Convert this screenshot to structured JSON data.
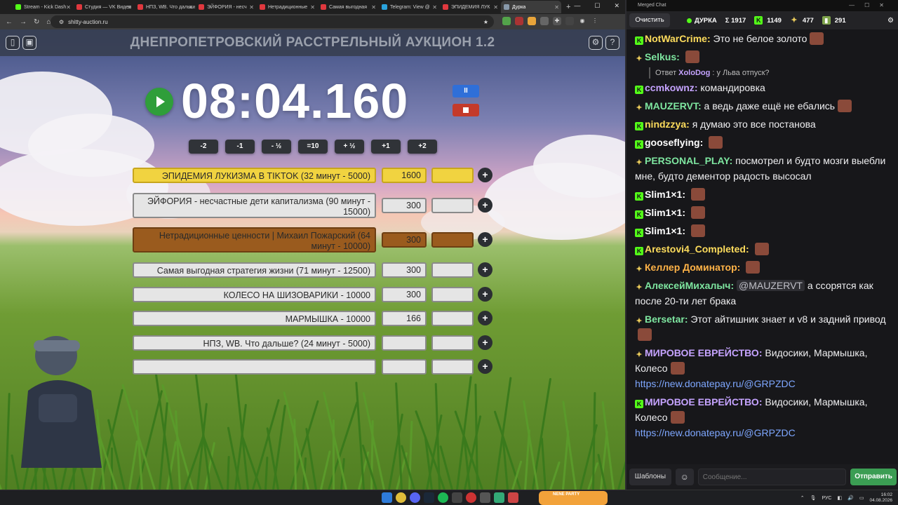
{
  "browser": {
    "tabs": [
      {
        "title": "Stream - Kick Dash",
        "color": "#53fc18",
        "active": false
      },
      {
        "title": "Студия — VK Видео",
        "color": "#e0383e",
        "active": false
      },
      {
        "title": "НПЗ, WB. Что дальше",
        "color": "#e0383e",
        "active": false
      },
      {
        "title": "ЭЙФОРИЯ - несч",
        "color": "#e0383e",
        "active": false
      },
      {
        "title": "Нетрадиционные",
        "color": "#e0383e",
        "active": false
      },
      {
        "title": "Самая выгодная",
        "color": "#e0383e",
        "active": false
      },
      {
        "title": "Telegram: View @",
        "color": "#2aa3dd",
        "active": false
      },
      {
        "title": "ЭПИДЕМИЯ ЛУК",
        "color": "#e0383e",
        "active": false
      },
      {
        "title": "Дурка",
        "color": "#8899aa",
        "active": true
      }
    ],
    "url": "shitty-auction.ru"
  },
  "auction": {
    "title": "ДНЕПРОПЕТРОВСКИЙ РАССТРЕЛЬНЫЙ АУКЦИОН 1.2",
    "timer": "08:04.160",
    "pause_label": "II",
    "adjust_buttons": [
      "-2",
      "-1",
      "- ½",
      "=10",
      "+ ½",
      "+1",
      "+2"
    ],
    "lots": [
      {
        "name": "ЭПИДЕМИЯ ЛУКИЗМА В TIKTOK (32 минут - 5000)",
        "amount": "1600",
        "style": "gold"
      },
      {
        "name": "ЭЙФОРИЯ - несчастные дети капитализма (90 минут - 15000)",
        "amount": "300",
        "style": "grey"
      },
      {
        "name": "Нетрадиционные ценности | Михаил Пожарский (64 минут - 10000)",
        "amount": "300",
        "style": "brown"
      },
      {
        "name": "Самая выгодная стратегия жизни (71 минут - 12500)",
        "amount": "300",
        "style": "grey"
      },
      {
        "name": "КОЛЕСО НА ШИЗОВАРИКИ - 10000",
        "amount": "300",
        "style": "grey"
      },
      {
        "name": "МАРМЫШКА - 10000",
        "amount": "166",
        "style": "grey"
      },
      {
        "name": "НПЗ, WB. Что дальше? (24 минут - 5000)",
        "amount": "",
        "style": "grey"
      },
      {
        "name": "",
        "amount": "",
        "style": "grey"
      }
    ],
    "plus_label": "+"
  },
  "chat": {
    "window_title": "Merged Chat",
    "clear_label": "Очистить",
    "status": "ДУРКА",
    "total": "Σ 1917",
    "kick_count": "1149",
    "other_count": "477",
    "vk_count": "291",
    "messages": [
      {
        "platform": "kick",
        "nick": "NotWarCrime",
        "color": "#fddc5c",
        "text": "Это не белое золото",
        "emote": true
      },
      {
        "platform": "bee",
        "nick": "Selkus",
        "color": "#7ee6a0",
        "text": "",
        "emote": true
      },
      {
        "reply": true,
        "reply_prefix": "Ответ",
        "reply_nick": "XoloDog",
        "reply_text": "у Льва отпуск?"
      },
      {
        "platform": "kick",
        "nick": "ccmkownz",
        "color": "#c5a3ff",
        "text": "командировка",
        "emote": false
      },
      {
        "platform": "bee",
        "nick": "MAUZERVT",
        "color": "#7ee6a0",
        "text": "а ведь даже ещё не ебались",
        "emote": true
      },
      {
        "platform": "kick",
        "nick": "nindzzya",
        "color": "#fddc5c",
        "text": "я думаю это все постанова",
        "emote": false
      },
      {
        "platform": "kick",
        "nick": "gooseflying",
        "color": "#ffffff",
        "text": "",
        "emote": true
      },
      {
        "platform": "bee",
        "nick": "PERSONAL_PLAY",
        "color": "#7ee6a0",
        "text": "посмотрел и будто мозги выебли мне, будто дементор радость высосал",
        "emote": false
      },
      {
        "platform": "kick",
        "nick": "Slim1×1",
        "color": "#ffffff",
        "text": "",
        "emote": true
      },
      {
        "platform": "kick",
        "nick": "Slim1×1",
        "color": "#ffffff",
        "text": "",
        "emote": true
      },
      {
        "platform": "kick",
        "nick": "Slim1×1",
        "color": "#ffffff",
        "text": "",
        "emote": true
      },
      {
        "platform": "kick",
        "nick": "Arestovi4_Completed",
        "color": "#fddc5c",
        "text": "",
        "emote": true
      },
      {
        "platform": "bee",
        "nick": "Келлер Доминатор",
        "color": "#ffb347",
        "text": "",
        "emote": true
      },
      {
        "platform": "bee",
        "nick": "АлексейМихалыч",
        "color": "#7ee6a0",
        "mention": "@MAUZERVT",
        "text": "а ссорятся как после 20-ти лет брака",
        "emote": false
      },
      {
        "platform": "bee",
        "nick": "Bersetar",
        "color": "#7ee6a0",
        "text": "Этот айтишник знает и v8 и задний привод",
        "emote": true
      },
      {
        "platform": "bee",
        "nick": "МИРОВОЕ ЕВРЕЙСТВО",
        "color": "#c5a3ff",
        "text": "Видосики, Мармышка, Колесо",
        "emote": true,
        "link": "https://new.donatepay.ru/@GRPZDC"
      },
      {
        "platform": "kick",
        "nick": "МИРОВОЕ ЕВРЕЙСТВО",
        "color": "#c5a3ff",
        "text": "Видосики, Мармышка, Колесо",
        "emote": true,
        "link": "https://new.donatepay.ru/@GRPZDC"
      }
    ],
    "templates_label": "Шаблоны",
    "input_placeholder": "Сообщение...",
    "send_label": "Отправить"
  },
  "taskbar": {
    "nene_label": "NENE PARTY",
    "lang": "РУС",
    "time": "16:02",
    "date": "04.08.2026"
  },
  "colors": {
    "accent_green": "#3b9d53",
    "kick_green": "#53fc18",
    "lot_gold": "#f1d340",
    "lot_brown": "#9a5b1e"
  }
}
